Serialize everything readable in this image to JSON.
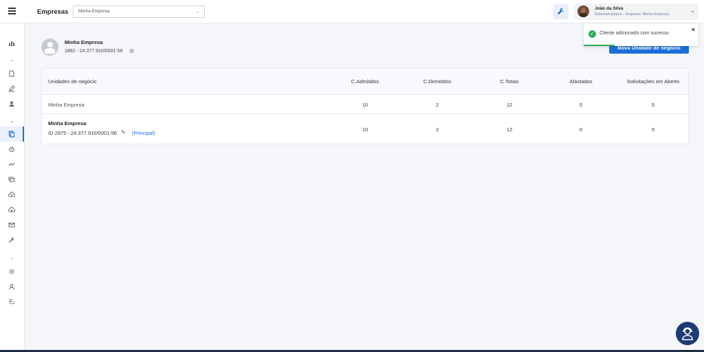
{
  "topbar": {
    "title": "Empresas",
    "company_select_value": "Minha Empresa",
    "user_name": "João da Silva",
    "user_role": "Administradores - Empresa: Minha Empresa"
  },
  "sidebar": {
    "icons": [
      "chart-icon",
      "document-icon",
      "pencil-icon",
      "user-icon",
      "companies-icon",
      "alarm-icon",
      "trend-icon",
      "chat-icon",
      "cloud-upload-icon",
      "cloud-download-icon",
      "mail-icon",
      "wrench-icon",
      "gear-icon",
      "user-settings-icon",
      "checklist-icon"
    ],
    "active": "companies-icon"
  },
  "company": {
    "name": "Minha Empresa",
    "id_line": "1882 - 24.377.910/0001-56"
  },
  "actions": {
    "new_unit": "Nova Unidade de negócio"
  },
  "table": {
    "columns": [
      "Unidades de negócio",
      "C.Admitidos",
      "C.Demitidos",
      "C.Totais",
      "Afastados",
      "Solicitações em Aberto"
    ],
    "rows": [
      {
        "name": "Minha Empresa",
        "values": [
          "10",
          "2",
          "12",
          "0",
          "5"
        ]
      },
      {
        "name": "Minha Empresa",
        "id_line": "ID 2975 - 24.377.910/0001-56",
        "tag": "(Principal)",
        "values": [
          "10",
          "2",
          "12",
          "0",
          "5"
        ]
      }
    ]
  },
  "toast": {
    "message": "Cliente adicionado com sucesso.",
    "progress": 0.27
  },
  "colors": {
    "accent": "#1a6fd8",
    "success": "#2eae5a",
    "chat_fab": "#1f3b73"
  }
}
